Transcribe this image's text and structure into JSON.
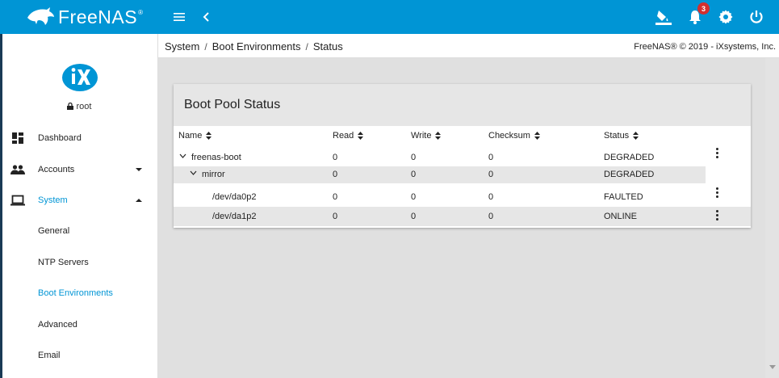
{
  "topbar": {
    "logo_text": "FreeNAS",
    "logo_reg": "®",
    "notification_count": "3",
    "colors": {
      "bar": "#0095d5",
      "badge": "#d32f2f"
    }
  },
  "sidebar": {
    "user": "root",
    "items": [
      {
        "label": "Dashboard",
        "icon": "dashboard-icon"
      },
      {
        "label": "Accounts",
        "icon": "people-icon"
      },
      {
        "label": "System",
        "icon": "laptop-icon"
      },
      {
        "label": "General"
      },
      {
        "label": "NTP Servers"
      },
      {
        "label": "Boot Environments"
      },
      {
        "label": "Advanced"
      },
      {
        "label": "Email"
      }
    ]
  },
  "breadcrumb": {
    "items": [
      "System",
      "Boot Environments",
      "Status"
    ],
    "copyright": "FreeNAS® © 2019 - iXsystems, Inc."
  },
  "card": {
    "title": "Boot Pool Status",
    "columns": [
      "Name",
      "Read",
      "Write",
      "Checksum",
      "Status"
    ],
    "rows": [
      {
        "name": "freenas-boot",
        "read": "0",
        "write": "0",
        "checksum": "0",
        "status": "DEGRADED"
      },
      {
        "name": "mirror",
        "read": "0",
        "write": "0",
        "checksum": "0",
        "status": "DEGRADED"
      },
      {
        "name": "/dev/da0p2",
        "read": "0",
        "write": "0",
        "checksum": "0",
        "status": "FAULTED"
      },
      {
        "name": "/dev/da1p2",
        "read": "0",
        "write": "0",
        "checksum": "0",
        "status": "ONLINE"
      }
    ]
  }
}
